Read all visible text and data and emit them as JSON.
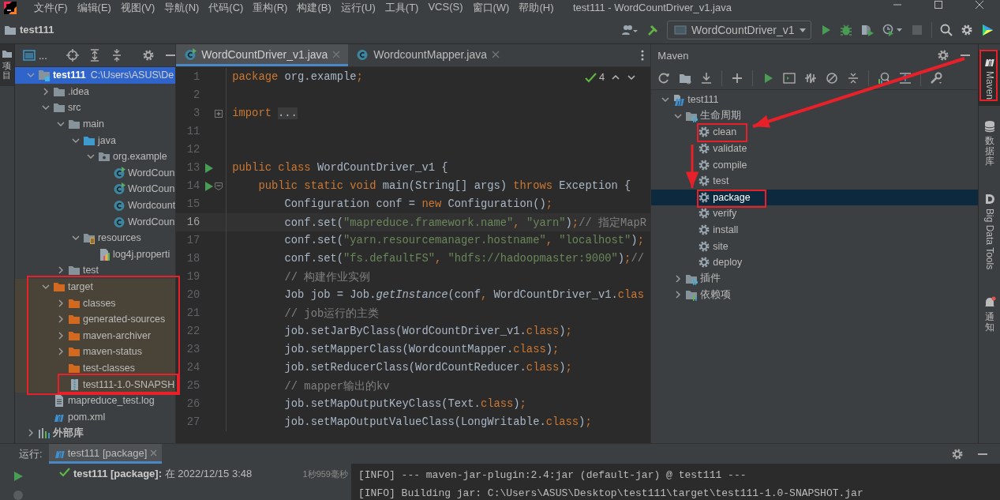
{
  "title_bar": {
    "menu": [
      "文件(F)",
      "编辑(E)",
      "视图(V)",
      "导航(N)",
      "代码(C)",
      "重构(R)",
      "构建(B)",
      "运行(U)",
      "工具(T)",
      "VCS(S)",
      "窗口(W)",
      "帮助(H)"
    ],
    "window_title": "test111 - WordCountDriver_v1.java"
  },
  "nav_bar": {
    "project": "test111",
    "run_config": "WordCountDriver_v1"
  },
  "left_strip": [
    {
      "label": "项目",
      "selected": true
    }
  ],
  "project_panel": {
    "view_label": "...",
    "tree": [
      {
        "label": "test111",
        "path": "C:\\Users\\ASUS\\De",
        "kind": "module",
        "expanded": true,
        "selected": true,
        "children": [
          {
            "label": ".idea",
            "kind": "folder",
            "expanded": false,
            "selected": false
          },
          {
            "label": "src",
            "kind": "folder",
            "expanded": true,
            "selected": false,
            "children": [
              {
                "label": "main",
                "kind": "folder",
                "expanded": true,
                "selected": false,
                "children": [
                  {
                    "label": "java",
                    "kind": "source",
                    "expanded": true,
                    "selected": false,
                    "children": [
                      {
                        "label": "org.example",
                        "kind": "package",
                        "expanded": true,
                        "selected": false,
                        "children": [
                          {
                            "label": "WordCoun",
                            "kind": "main-class",
                            "selected": false
                          },
                          {
                            "label": "WordCoun",
                            "kind": "main-class",
                            "selected": false
                          },
                          {
                            "label": "Wordcount",
                            "kind": "class",
                            "selected": false
                          },
                          {
                            "label": "WordCoun",
                            "kind": "class",
                            "selected": false
                          }
                        ]
                      }
                    ]
                  },
                  {
                    "label": "resources",
                    "kind": "resources",
                    "expanded": true,
                    "selected": false,
                    "children": [
                      {
                        "label": "log4j.properti",
                        "kind": "properties",
                        "selected": false
                      }
                    ]
                  }
                ]
              },
              {
                "label": "test",
                "kind": "folder",
                "expanded": false,
                "selected": false
              }
            ]
          },
          {
            "label": "target",
            "kind": "excluded-folder",
            "expanded": true,
            "selected": false,
            "excluded": true,
            "children": [
              {
                "label": "classes",
                "kind": "excluded-folder",
                "expanded": false,
                "selected": false,
                "excluded": true
              },
              {
                "label": "generated-sources",
                "kind": "excluded-folder",
                "expanded": false,
                "selected": false,
                "excluded": true
              },
              {
                "label": "maven-archiver",
                "kind": "excluded-folder",
                "expanded": false,
                "selected": false,
                "excluded": true
              },
              {
                "label": "maven-status",
                "kind": "excluded-folder",
                "expanded": false,
                "selected": false,
                "excluded": true
              },
              {
                "label": "test-classes",
                "kind": "excluded-folder",
                "selected": false,
                "excluded": true
              },
              {
                "label": "test111-1.0-SNAPSH",
                "kind": "jar",
                "selected": false,
                "excluded": true
              }
            ]
          },
          {
            "label": "mapreduce_test.log",
            "kind": "log",
            "selected": false
          },
          {
            "label": "pom.xml",
            "kind": "pom",
            "selected": false
          }
        ]
      },
      {
        "label": "外部库",
        "kind": "library",
        "expanded": false,
        "selected": false
      }
    ]
  },
  "editor": {
    "tabs": [
      {
        "label": "WordCountDriver_v1.java",
        "selected": true,
        "kind": "main-class"
      },
      {
        "label": "WordcountMapper.java",
        "selected": false,
        "kind": "class"
      }
    ],
    "inspections": "4",
    "lines": [
      {
        "number": "1",
        "current": false,
        "tokens": [
          {
            "kind": "keyword",
            "text": "package"
          },
          {
            "kind": "plain",
            "text": " org.example"
          },
          {
            "kind": "keyword",
            "text": ";"
          }
        ]
      },
      {
        "number": "2",
        "current": false
      },
      {
        "number": "3",
        "current": false,
        "fold_marker": true,
        "collapsed": true,
        "tokens": [
          {
            "kind": "keyword",
            "text": "import"
          },
          {
            "kind": "folded",
            "text": "..."
          }
        ]
      },
      {
        "number": "11",
        "current": false
      },
      {
        "number": "12",
        "current": false
      },
      {
        "number": "13",
        "current": false,
        "run": true,
        "tokens": [
          {
            "kind": "keyword",
            "text": "public class "
          },
          {
            "kind": "plain",
            "text": "WordCountDriver_v1 {"
          }
        ]
      },
      {
        "number": "14",
        "current": false,
        "run": true,
        "fold_marker": true,
        "collapsed": false,
        "tokens": [
          {
            "kind": "keyword",
            "text": "    public static void "
          },
          {
            "kind": "plain",
            "text": "main(String[] args) "
          },
          {
            "kind": "keyword",
            "text": "throws "
          },
          {
            "kind": "plain",
            "text": "Exception {"
          }
        ]
      },
      {
        "number": "15",
        "current": false,
        "tokens": [
          {
            "kind": "plain",
            "text": "        Configuration conf = "
          },
          {
            "kind": "keyword",
            "text": "new "
          },
          {
            "kind": "plain",
            "text": "Configuration()"
          },
          {
            "kind": "keyword",
            "text": ";"
          }
        ]
      },
      {
        "number": "16",
        "current": true,
        "tokens": [
          {
            "kind": "plain",
            "text": "        conf.set("
          },
          {
            "kind": "string",
            "text": "\"mapreduce.framework.name\""
          },
          {
            "kind": "keyword",
            "text": ", "
          },
          {
            "kind": "string",
            "text": "\"yarn\""
          },
          {
            "kind": "plain",
            "text": ")"
          },
          {
            "kind": "keyword",
            "text": ";"
          },
          {
            "kind": "comment",
            "text": "// 指定MapR"
          }
        ]
      },
      {
        "number": "17",
        "current": false,
        "tokens": [
          {
            "kind": "plain",
            "text": "        conf.set("
          },
          {
            "kind": "string",
            "text": "\"yarn.resourcemanager.hostname\""
          },
          {
            "kind": "keyword",
            "text": ", "
          },
          {
            "kind": "string",
            "text": "\"localhost\""
          },
          {
            "kind": "plain",
            "text": ")"
          },
          {
            "kind": "keyword",
            "text": ";"
          }
        ]
      },
      {
        "number": "18",
        "current": false,
        "tokens": [
          {
            "kind": "plain",
            "text": "        conf.set("
          },
          {
            "kind": "string",
            "text": "\"fs.defaultFS\""
          },
          {
            "kind": "keyword",
            "text": ", "
          },
          {
            "kind": "string",
            "text": "\"hdfs://hadoopmaster:9000\""
          },
          {
            "kind": "plain",
            "text": ")"
          },
          {
            "kind": "keyword",
            "text": ";"
          },
          {
            "kind": "comment",
            "text": "//"
          }
        ]
      },
      {
        "number": "19",
        "current": false,
        "tokens": [
          {
            "kind": "comment",
            "text": "        // 构建作业实例"
          }
        ]
      },
      {
        "number": "20",
        "current": false,
        "tokens": [
          {
            "kind": "plain",
            "text": "        Job job = Job."
          },
          {
            "kind": "italic",
            "text": "getInstance"
          },
          {
            "kind": "plain",
            "text": "(conf"
          },
          {
            "kind": "keyword",
            "text": ", "
          },
          {
            "kind": "plain",
            "text": "WordCountDriver_v1."
          },
          {
            "kind": "keyword",
            "text": "clas"
          }
        ]
      },
      {
        "number": "21",
        "current": false,
        "tokens": [
          {
            "kind": "comment",
            "text": "        // job运行的主类"
          }
        ]
      },
      {
        "number": "22",
        "current": false,
        "tokens": [
          {
            "kind": "plain",
            "text": "        job.setJarByClass(WordCountDriver_v1."
          },
          {
            "kind": "keyword",
            "text": "class"
          },
          {
            "kind": "plain",
            "text": ")"
          },
          {
            "kind": "keyword",
            "text": ";"
          }
        ]
      },
      {
        "number": "23",
        "current": false,
        "tokens": [
          {
            "kind": "plain",
            "text": "        job.setMapperClass(WordcountMapper."
          },
          {
            "kind": "keyword",
            "text": "class"
          },
          {
            "kind": "plain",
            "text": ")"
          },
          {
            "kind": "keyword",
            "text": ";"
          }
        ]
      },
      {
        "number": "24",
        "current": false,
        "tokens": [
          {
            "kind": "plain",
            "text": "        job.setReducerClass(WordCountReducer."
          },
          {
            "kind": "keyword",
            "text": "class"
          },
          {
            "kind": "plain",
            "text": ")"
          },
          {
            "kind": "keyword",
            "text": ";"
          }
        ]
      },
      {
        "number": "25",
        "current": false,
        "tokens": [
          {
            "kind": "comment",
            "text": "        // mapper输出的kv"
          }
        ]
      },
      {
        "number": "26",
        "current": false,
        "tokens": [
          {
            "kind": "plain",
            "text": "        job.setMapOutputKeyClass(Text."
          },
          {
            "kind": "keyword",
            "text": "class"
          },
          {
            "kind": "plain",
            "text": ")"
          },
          {
            "kind": "keyword",
            "text": ";"
          }
        ]
      },
      {
        "number": "27",
        "current": false,
        "tokens": [
          {
            "kind": "plain",
            "text": "        job.setMapOutputValueClass(LongWritable."
          },
          {
            "kind": "keyword",
            "text": "class"
          },
          {
            "kind": "plain",
            "text": ")"
          },
          {
            "kind": "keyword",
            "text": ";"
          }
        ]
      }
    ]
  },
  "maven": {
    "title": "Maven",
    "tree": [
      {
        "label": "test111",
        "kind": "project",
        "expanded": true,
        "selected": false,
        "children": [
          {
            "label": "生命周期",
            "kind": "lifecycle",
            "expanded": true,
            "selected": false,
            "children": [
              {
                "label": "clean",
                "kind": "goal",
                "selected": false
              },
              {
                "label": "validate",
                "kind": "goal",
                "selected": false
              },
              {
                "label": "compile",
                "kind": "goal",
                "selected": false
              },
              {
                "label": "test",
                "kind": "goal",
                "selected": false
              },
              {
                "label": "package",
                "kind": "goal",
                "selected": true
              },
              {
                "label": "verify",
                "kind": "goal",
                "selected": false
              },
              {
                "label": "install",
                "kind": "goal",
                "selected": false
              },
              {
                "label": "site",
                "kind": "goal",
                "selected": false
              },
              {
                "label": "deploy",
                "kind": "goal",
                "selected": false
              }
            ]
          },
          {
            "label": "插件",
            "kind": "plugins",
            "expanded": false,
            "selected": false
          },
          {
            "label": "依赖项",
            "kind": "dependencies",
            "expanded": false,
            "selected": false
          }
        ]
      }
    ]
  },
  "right_strip": [
    {
      "label": "Maven",
      "kind": "maven",
      "selected": true
    },
    {
      "label": "数据库",
      "kind": "database",
      "selected": false
    },
    {
      "label": "Big Data Tools",
      "kind": "bigdata",
      "selected": false
    },
    {
      "label": "通知",
      "kind": "notifications",
      "selected": false
    }
  ],
  "run_panel": {
    "label": "运行:",
    "tab": "test111 [package]",
    "result": "**test111 [package]:** 在 2022/12/15 3:48",
    "success": true,
    "duration": "1秒959毫秒",
    "console": [
      "[INFO] --- maven-jar-plugin:2.4:jar (default-jar) @ test111 ---",
      "[INFO] Building jar: C:\\Users\\ASUS\\Desktop\\test111\\target\\test111-1.0-SNAPSHOT.jar"
    ]
  },
  "annotations": true
}
